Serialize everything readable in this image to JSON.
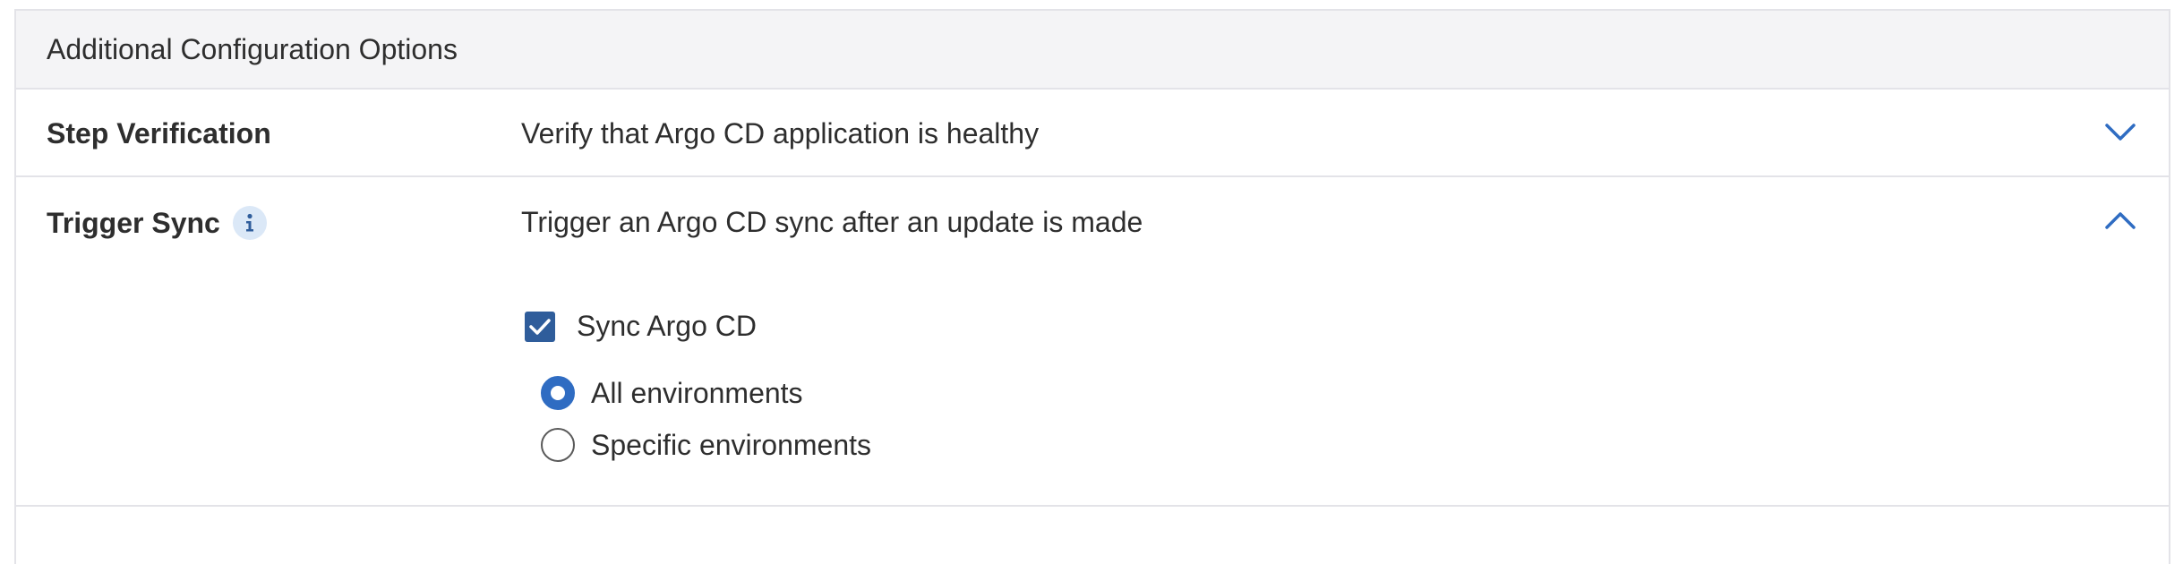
{
  "panel": {
    "header_title": "Additional Configuration Options"
  },
  "step_verification": {
    "title": "Step Verification",
    "description": "Verify that Argo CD application is healthy",
    "chevron_icon": "chevron-down-icon",
    "expanded": false
  },
  "trigger_sync": {
    "title": "Trigger Sync",
    "info_icon": "info-icon",
    "description": "Trigger an Argo CD sync after an update is made",
    "chevron_icon": "chevron-up-icon",
    "expanded": true,
    "sync_checkbox": {
      "label": "Sync Argo CD",
      "checked": true
    },
    "environment_options": [
      {
        "label": "All environments",
        "selected": true
      },
      {
        "label": "Specific environments",
        "selected": false
      }
    ]
  },
  "colors": {
    "accent_blue": "#2f6cc2",
    "checkbox_blue": "#2f5d9b",
    "header_bg": "#f4f4f6",
    "border": "#e3e3e8",
    "info_badge_bg": "#dbe8f7"
  }
}
